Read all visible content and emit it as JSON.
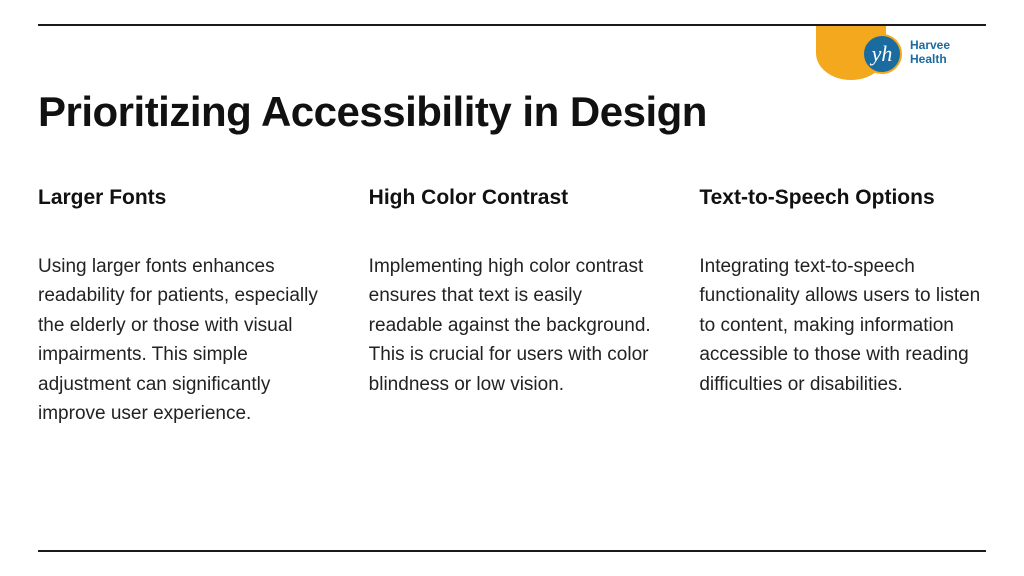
{
  "logo": {
    "glyph": "yh",
    "line1": "Harvee",
    "line2": "Health"
  },
  "title": "Prioritizing Accessibility in Design",
  "columns": [
    {
      "heading": "Larger Fonts",
      "body": "Using larger fonts enhances readability for patients, especially the elderly or those with visual impairments. This simple adjustment can significantly improve user experience."
    },
    {
      "heading": "High Color Contrast",
      "body": "Implementing high color contrast ensures that text is easily readable against the background. This is crucial for users with color blindness or low vision."
    },
    {
      "heading": "Text-to-Speech Options",
      "body": "Integrating text-to-speech functionality allows users to listen to content, making information accessible to those with reading difficulties or disabilities."
    }
  ]
}
